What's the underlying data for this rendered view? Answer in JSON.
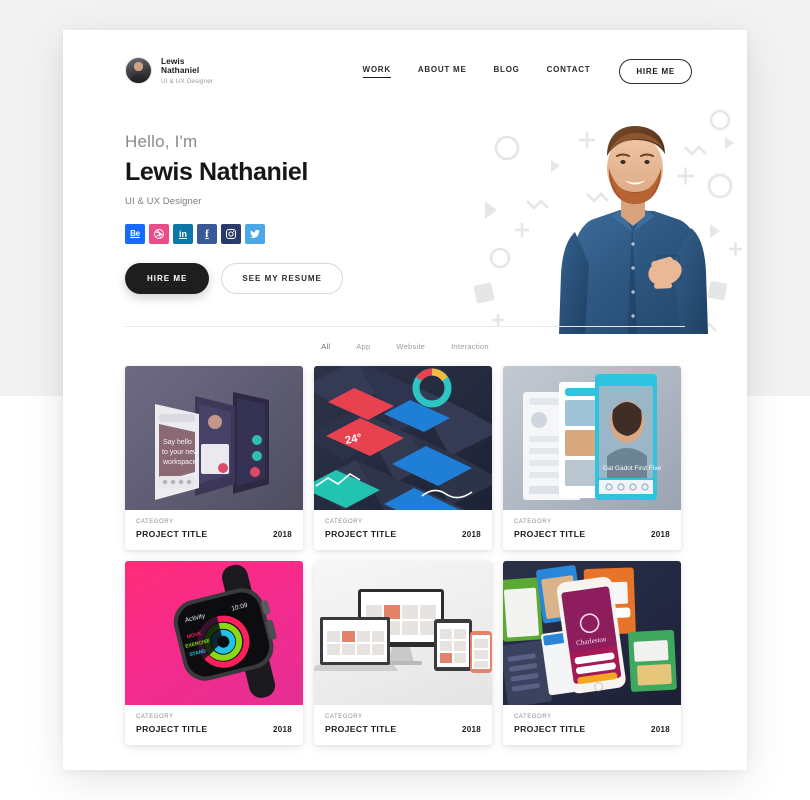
{
  "brand": {
    "name_line1": "Lewis",
    "name_line2": "Nathaniel",
    "role": "UI & UX Designer",
    "avatar_icon": "user-avatar"
  },
  "nav": {
    "items": [
      {
        "label": "WORK",
        "active": true
      },
      {
        "label": "ABOUT ME",
        "active": false
      },
      {
        "label": "BLOG",
        "active": false
      },
      {
        "label": "CONTACT",
        "active": false
      }
    ],
    "cta_label": "HIRE ME"
  },
  "hero": {
    "greeting": "Hello, I'm",
    "name": "Lewis Nathaniel",
    "role": "UI & UX Designer",
    "primary_button": "HIRE ME",
    "secondary_button": "SEE MY RESUME",
    "photo_alt": "portrait of bearded man in denim shirt extending hand",
    "socials": [
      {
        "name": "behance",
        "glyph": "Be",
        "color": "#1769ff"
      },
      {
        "name": "dribbble",
        "glyph": "dribbble",
        "color": "#ea4c89"
      },
      {
        "name": "linkedin",
        "glyph": "in",
        "color": "#0e76a8"
      },
      {
        "name": "facebook",
        "glyph": "f",
        "color": "#3b5998"
      },
      {
        "name": "instagram",
        "glyph": "instagram",
        "color": "#2a3a6b"
      },
      {
        "name": "twitter",
        "glyph": "twitter",
        "color": "#4aa7e8"
      }
    ]
  },
  "filters": [
    {
      "label": "All",
      "active": true
    },
    {
      "label": "App",
      "active": false
    },
    {
      "label": "Website",
      "active": false
    },
    {
      "label": "Interaction",
      "active": false
    }
  ],
  "projects": [
    {
      "category": "CATEGORY",
      "title": "PROJECT TITLE",
      "year": "2018",
      "thumb": "t1",
      "thumb_alt": "mobile app screens mockup, say hello to your new workspace"
    },
    {
      "category": "CATEGORY",
      "title": "PROJECT TITLE",
      "year": "2018",
      "thumb": "t2",
      "thumb_alt": "isometric dark dashboard ui screens"
    },
    {
      "category": "CATEGORY",
      "title": "PROJECT TITLE",
      "year": "2018",
      "thumb": "t3",
      "thumb_alt": "light cyan social app screens"
    },
    {
      "category": "CATEGORY",
      "title": "PROJECT TITLE",
      "year": "2018",
      "thumb": "t4",
      "thumb_alt": "smart watch activity rings on pink background"
    },
    {
      "category": "CATEGORY",
      "title": "PROJECT TITLE",
      "year": "2018",
      "thumb": "t5",
      "thumb_alt": "responsive device mockups desktop laptop tablet phone"
    },
    {
      "category": "CATEGORY",
      "title": "PROJECT TITLE",
      "year": "2018",
      "thumb": "t6",
      "thumb_alt": "colorful app screens with white phone on navy"
    }
  ],
  "thumb_text": {
    "card1_line1": "Say hello",
    "card1_line2": "to your new",
    "card1_line3": "workspace",
    "card2_temp": "24°",
    "card4_label": "Activity",
    "card4_time": "10:09",
    "card4_ring1": "MOVE",
    "card4_ring2": "EXERCISE",
    "card4_ring3": "STAND"
  },
  "colors": {
    "page_bg": "#ffffff",
    "backdrop_top": "#f2f2f2",
    "backdrop_bottom": "#ffffff",
    "text_dark": "#161616",
    "text_muted": "#8a8a8a",
    "accent_dark": "#1e1e1e"
  }
}
